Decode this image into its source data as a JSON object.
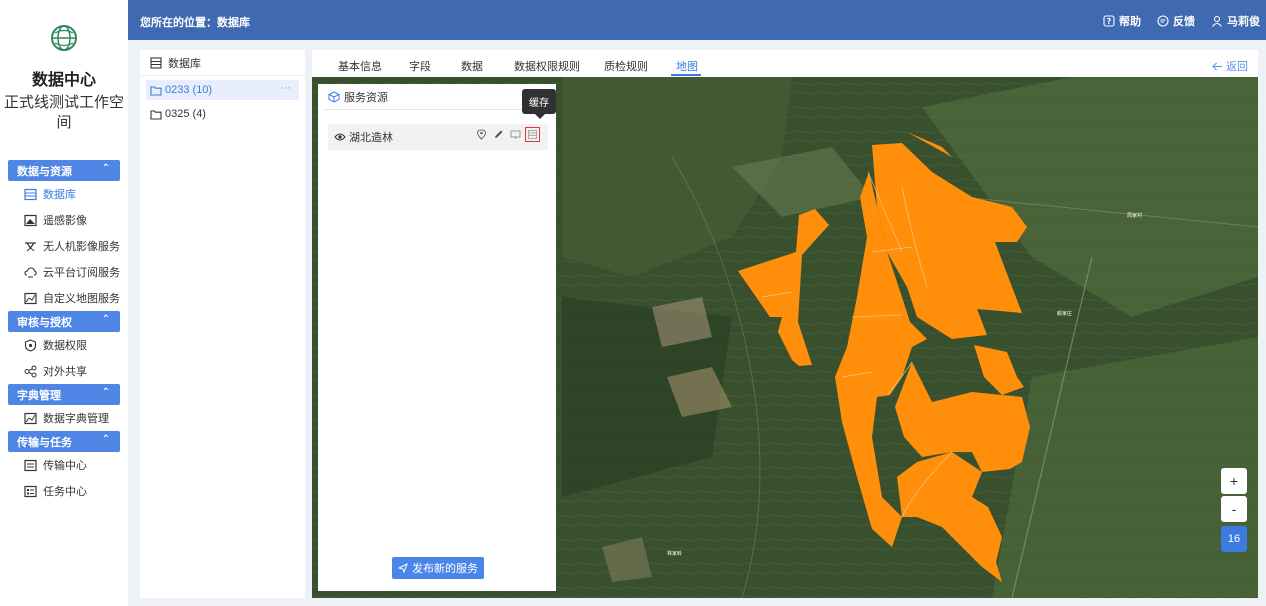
{
  "sidebar": {
    "title": "数据中心",
    "workspace": "正式线测试工作空间",
    "groups": [
      {
        "label": "数据与资源",
        "items": [
          {
            "label": "数据库",
            "icon": "database-icon"
          },
          {
            "label": "遥感影像",
            "icon": "remote-sensing-icon"
          },
          {
            "label": "无人机影像服务",
            "icon": "drone-icon"
          },
          {
            "label": "云平台订阅服务",
            "icon": "cloud-icon"
          },
          {
            "label": "自定义地图服务",
            "icon": "map-icon"
          }
        ]
      },
      {
        "label": "审核与授权",
        "items": [
          {
            "label": "数据权限",
            "icon": "shield-icon"
          },
          {
            "label": "对外共享",
            "icon": "share-icon"
          }
        ]
      },
      {
        "label": "字典管理",
        "items": [
          {
            "label": "数据字典管理",
            "icon": "dictionary-icon"
          }
        ]
      },
      {
        "label": "传输与任务",
        "items": [
          {
            "label": "传输中心",
            "icon": "transfer-icon"
          },
          {
            "label": "任务中心",
            "icon": "task-icon"
          }
        ]
      }
    ]
  },
  "topbar": {
    "breadcrumb": "您所在的位置：数据库",
    "help": "帮助",
    "feedback": "反馈",
    "user": "马莉俊"
  },
  "db_panel": {
    "header": "数据库",
    "items": [
      "0233 (10)",
      "0325 (4)"
    ],
    "more": "···"
  },
  "tabs": [
    "基本信息",
    "字段",
    "数据",
    "数据权限规则",
    "质检规则",
    "地图"
  ],
  "active_tab": "地图",
  "back_label": "返回",
  "service_panel": {
    "header": "服务资源",
    "row_label": "湖北造林",
    "tooltip": "缓存",
    "publish_label": "发布新的服务"
  },
  "map": {
    "zoom_in": "+",
    "zoom_out": "-",
    "zoom_level": "16",
    "labels": [
      "周家村",
      "颜家庄",
      "林家岭"
    ],
    "polygon_color": "#ff8f0a"
  }
}
